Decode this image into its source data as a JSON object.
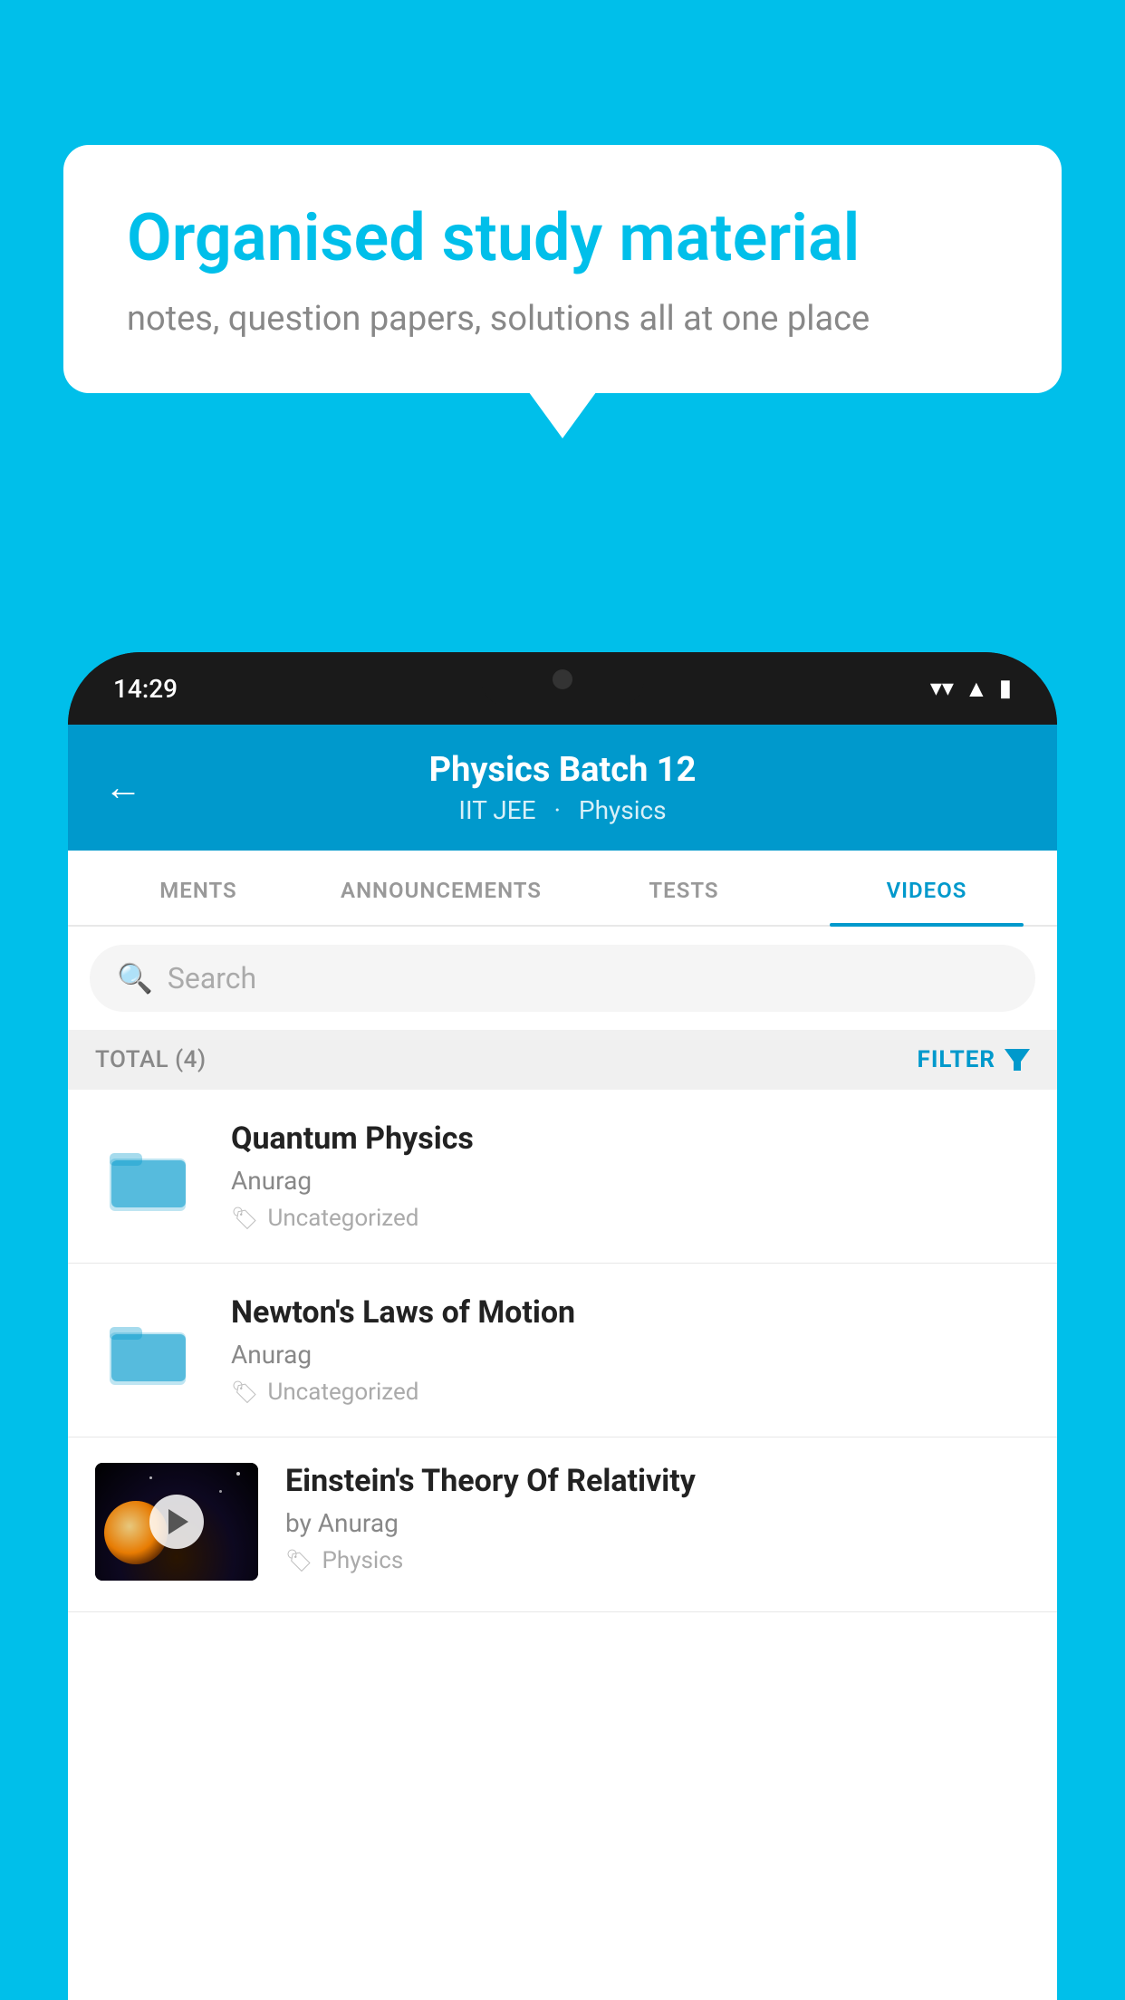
{
  "background_color": "#00BFEA",
  "speech_bubble": {
    "title": "Organised study material",
    "subtitle": "notes, question papers, solutions all at one place"
  },
  "phone": {
    "status_bar": {
      "time": "14:29"
    },
    "header": {
      "title": "Physics Batch 12",
      "subtitle_part1": "IIT JEE",
      "subtitle_part2": "Physics",
      "back_label": "←"
    },
    "tabs": [
      {
        "label": "MENTS",
        "active": false
      },
      {
        "label": "ANNOUNCEMENTS",
        "active": false
      },
      {
        "label": "TESTS",
        "active": false
      },
      {
        "label": "VIDEOS",
        "active": true
      }
    ],
    "search": {
      "placeholder": "Search"
    },
    "filter_row": {
      "total_label": "TOTAL (4)",
      "filter_label": "FILTER"
    },
    "videos": [
      {
        "id": "quantum",
        "title": "Quantum Physics",
        "author": "Anurag",
        "tag": "Uncategorized",
        "has_thumb": false
      },
      {
        "id": "newton",
        "title": "Newton's Laws of Motion",
        "author": "Anurag",
        "tag": "Uncategorized",
        "has_thumb": false
      },
      {
        "id": "einstein",
        "title": "Einstein's Theory Of Relativity",
        "author": "by Anurag",
        "tag": "Physics",
        "has_thumb": true
      }
    ]
  }
}
